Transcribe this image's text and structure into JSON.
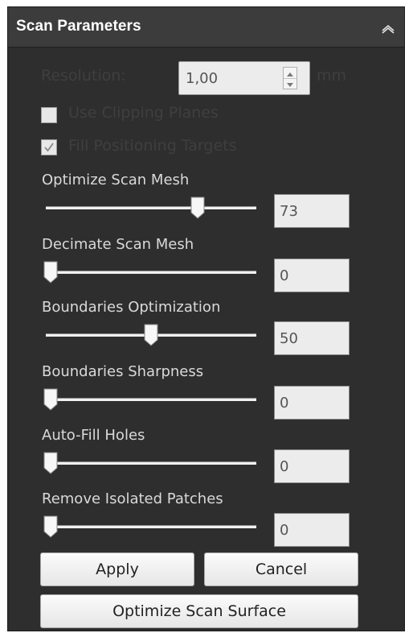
{
  "panel": {
    "title": "Scan Parameters",
    "collapse_icon": "chevron-up-icon"
  },
  "resolution": {
    "label": "Resolution:",
    "value": "1,00",
    "unit": "mm"
  },
  "options": {
    "clipping_planes": {
      "label": "Use Clipping Planes",
      "checked": false
    },
    "fill_targets": {
      "label": "Fill Positioning Targets",
      "checked": true
    }
  },
  "sliders": [
    {
      "label": "Optimize Scan Mesh",
      "value": "73",
      "level": 73
    },
    {
      "label": "Decimate Scan Mesh",
      "value": "0",
      "level": 0
    },
    {
      "label": "Boundaries Optimization",
      "value": "50",
      "level": 50
    },
    {
      "label": "Boundaries Sharpness",
      "value": "0",
      "level": 0
    },
    {
      "label": "Auto-Fill Holes",
      "value": "0",
      "level": 0
    },
    {
      "label": "Remove Isolated Patches",
      "value": "0",
      "level": 0
    }
  ],
  "buttons": {
    "apply": "Apply",
    "cancel": "Cancel",
    "optimize": "Optimize Scan Surface"
  }
}
